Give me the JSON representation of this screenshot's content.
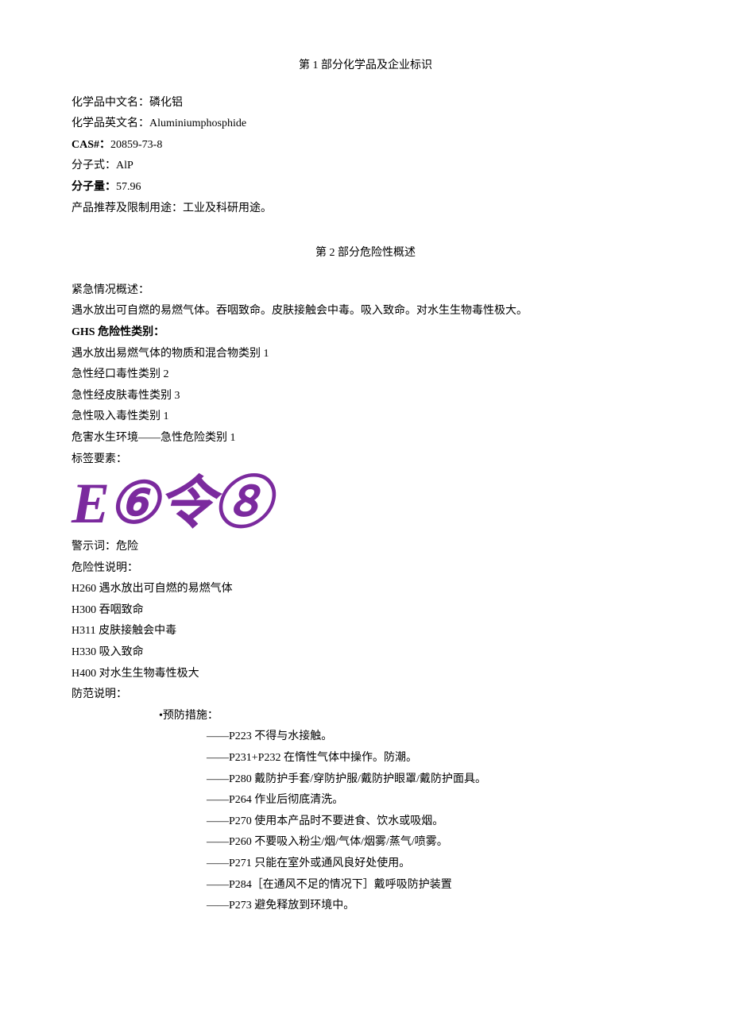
{
  "section1": {
    "title": "第 1 部分化学品及企业标识",
    "chineseNameLabel": "化学品中文名：",
    "chineseName": "磷化铝",
    "englishNameLabel": "化学品英文名：",
    "englishName": "Aluminiumphosphide",
    "casLabel": "CAS#：",
    "cas": "20859-73-8",
    "formulaLabel": "分子式：",
    "formula": "AlP",
    "molWeightLabel": "分子量：",
    "molWeight": "57.96",
    "recommendedUseLabel": "产品推荐及限制用途：",
    "recommendedUse": "工业及科研用途。"
  },
  "section2": {
    "title": "第 2 部分危险性概述",
    "emergencyLabel": "紧急情况概述：",
    "emergencyText": "遇水放出可自燃的易燃气体。吞咽致命。皮肤接触会中毒。吸入致命。对水生生物毒性极大。",
    "ghsLabel": "GHS 危险性类别：",
    "ghsClass1": "遇水放出易燃气体的物质和混合物类别 1",
    "ghsClass2": "急性经口毒性类别 2",
    "ghsClass3": "急性经皮肤毒性类别 3",
    "ghsClass4": "急性吸入毒性类别 1",
    "ghsClass5": "危害水生环境——急性危险类别 1",
    "labelElements": "标签要素：",
    "pictogram": "E⑥令⑧",
    "signalWordLabel": "警示词：",
    "signalWord": "危险",
    "hazardStatementLabel": "危险性说明：",
    "h260": "H260 遇水放出可自燃的易燃气体",
    "h300": "H300 吞咽致命",
    "h311": "H311 皮肤接触会中毒",
    "h330": "H330 吸入致命",
    "h400": "H400 对水生生物毒性极大",
    "precautionLabel": "防范说明：",
    "preventionLabel": "•预防措施：",
    "p223": "——P223 不得与水接触。",
    "p231_232": "——P231+P232 在惰性气体中操作。防潮。",
    "p280": "——P280 戴防护手套/穿防护服/戴防护眼罩/戴防护面具。",
    "p264": "——P264 作业后彻底清洗。",
    "p270": "——P270 使用本产品时不要进食、饮水或吸烟。",
    "p260": "——P260 不要吸入粉尘/烟/气体/烟雾/蒸气/喷雾。",
    "p271": "——P271 只能在室外或通风良好处使用。",
    "p284": "——P284［在通风不足的情况下］戴呼吸防护装置",
    "p273": "——P273 避免释放到环境中。"
  }
}
